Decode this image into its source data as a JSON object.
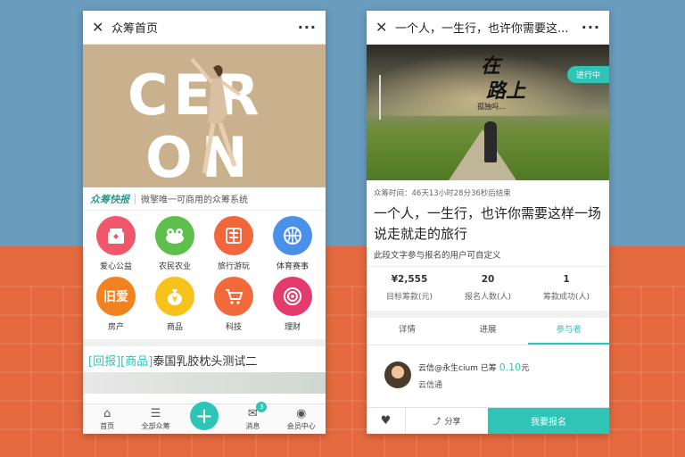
{
  "colors": {
    "accent": "#2ec4b6"
  },
  "left": {
    "title": "众筹首页",
    "banner_text_1": "CER",
    "banner_text_2": "ON",
    "news_label": "众筹快报",
    "news_text": "微擎唯一可商用的众筹系统",
    "categories": [
      {
        "label": "爱心公益",
        "color": "#f0576b",
        "icon": "gift-icon"
      },
      {
        "label": "农民农业",
        "color": "#5cc04a",
        "icon": "frog-icon"
      },
      {
        "label": "旅行游玩",
        "color": "#f3663c",
        "icon": "sign-icon"
      },
      {
        "label": "体育赛事",
        "color": "#4a8fe8",
        "icon": "ball-icon"
      },
      {
        "label": "房产",
        "color": "#f2821f",
        "icon": "house-icon",
        "glyph": "旧爱"
      },
      {
        "label": "商品",
        "color": "#f7c31b",
        "icon": "money-bag-icon"
      },
      {
        "label": "科技",
        "color": "#f26a3b",
        "icon": "cart-icon"
      },
      {
        "label": "理财",
        "color": "#e33b6e",
        "icon": "target-icon"
      }
    ],
    "promo_tag_1": "[回报]",
    "promo_tag_2": "[商品]",
    "promo_text": "泰国乳胶枕头测试二",
    "tabbar": {
      "home": "首页",
      "all": "全部众筹",
      "plus": "+",
      "messages": "消息",
      "messages_badge": "3",
      "member": "会员中心"
    }
  },
  "right": {
    "title": "一个人，一生行，也许你需要这...",
    "banner_zai": "在",
    "banner_lu": "路上",
    "banner_sub": "孤独吗...",
    "status": "进行中",
    "deadline": "众筹时间：46天13小时28分36秒后结束",
    "project_title": "一个人，一生行，也许你需要这样一场说走就走的旅行",
    "custom_text": "此段文字参与报名的用户可自定义",
    "stats": [
      {
        "value": "¥2,555",
        "label": "目标筹款(元)"
      },
      {
        "value": "20",
        "label": "报名人数(人)"
      },
      {
        "value": "1",
        "label": "筹款成功(人)"
      }
    ],
    "tabs": [
      "详情",
      "进展",
      "参与者"
    ],
    "supporter": {
      "name": "云信@永生cium",
      "verb": "已筹",
      "amount": "0.10",
      "unit": "元",
      "sub": "云信通"
    },
    "actions": {
      "share": "分享",
      "join": "我要报名"
    }
  }
}
